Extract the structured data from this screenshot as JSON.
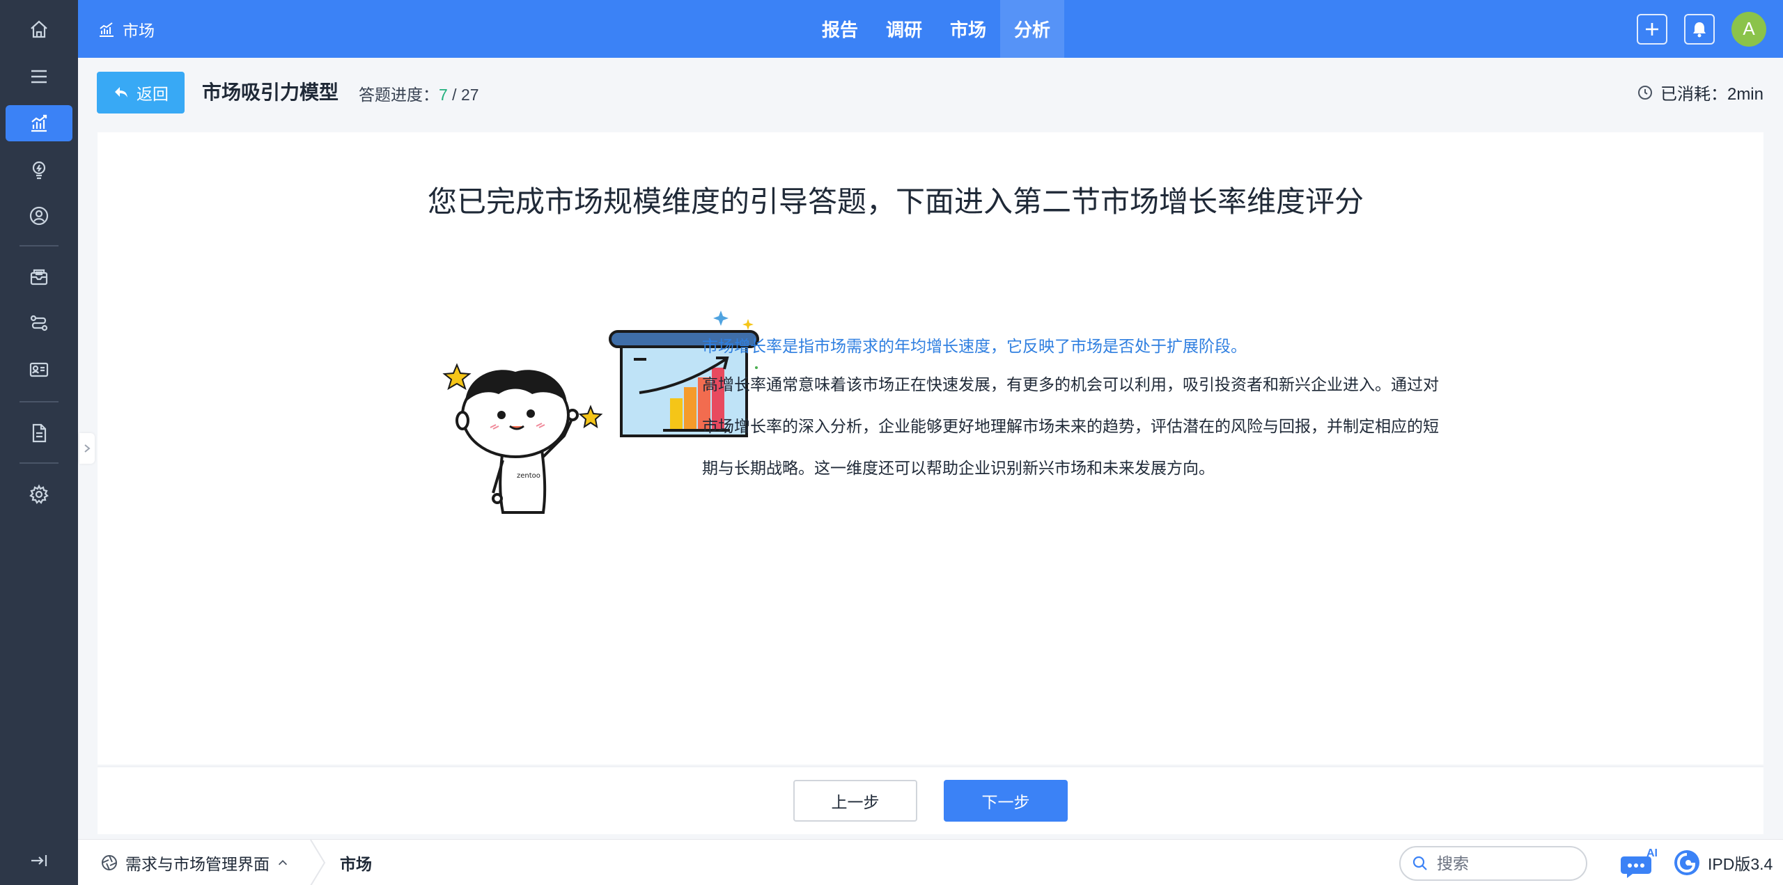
{
  "topbar": {
    "brand": "市场",
    "nav": [
      {
        "label": "报告",
        "active": false
      },
      {
        "label": "调研",
        "active": false
      },
      {
        "label": "市场",
        "active": false
      },
      {
        "label": "分析",
        "active": true
      }
    ],
    "avatar_initial": "A"
  },
  "sidebar": {
    "items": [
      "home-icon",
      "menu-icon",
      "chart-icon",
      "idea-icon",
      "user-icon",
      "mail-icon",
      "route-icon",
      "id-card-icon",
      "document-icon",
      "settings-icon"
    ],
    "active": "chart-icon"
  },
  "subheader": {
    "back_label": "返回",
    "title": "市场吸引力模型",
    "progress_label": "答题进度：",
    "progress_current": "7",
    "progress_sep": " / ",
    "progress_total": "27",
    "elapsed_label": "已消耗：2min"
  },
  "main": {
    "headline": "您已完成市场规模维度的引导答题，下面进入第二节市场增长率维度评分",
    "lead": "市场增长率是指市场需求的年均增长速度，它反映了市场是否处于扩展阶段。",
    "body": "高增长率通常意味着该市场正在快速发展，有更多的机会可以利用，吸引投资者和新兴企业进入。通过对市场增长率的深入分析，企业能够更好地理解市场未来的趋势，评估潜在的风险与回报，并制定相应的短期与长期战略。这一维度还可以帮助企业识别新兴市场和未来发展方向。",
    "illustration_shirt_text": "zentoo"
  },
  "footer": {
    "prev_label": "上一步",
    "next_label": "下一步"
  },
  "statusbar": {
    "system_label": "需求与市场管理界面",
    "crumb": "市场",
    "search_placeholder": "搜索",
    "ai_badge": "AI",
    "version": "IPD版3.4"
  },
  "colors": {
    "primary": "#3b82f6",
    "sidebar": "#2d3748",
    "back_button": "#38a9f5",
    "progress_current": "#22b07d",
    "lead_text": "#2f7fe0",
    "avatar": "#8bc34a"
  }
}
